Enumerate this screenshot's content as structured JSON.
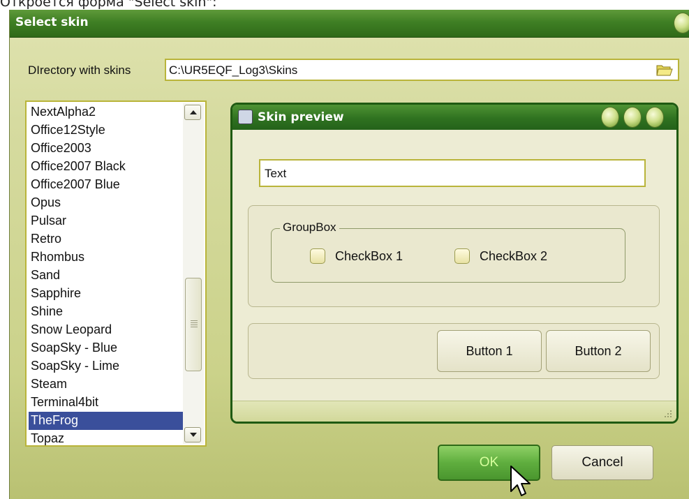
{
  "caption": "Откроется форма \"Select skin\":",
  "window": {
    "title": "Select skin",
    "directory_label": "DIrectory with skins",
    "directory_value": "C:\\UR5EQF_Log3\\Skins",
    "folder_icon": "folder-open-icon"
  },
  "skins": {
    "items": [
      "NextAlpha2",
      "Office12Style",
      "Office2003",
      "Office2007 Black",
      "Office2007 Blue",
      "Opus",
      "Pulsar",
      "Retro",
      "Rhombus",
      "Sand",
      "Sapphire",
      "Shine",
      "Snow Leopard",
      "SoapSky - Blue",
      "SoapSky - Lime",
      "Steam",
      "Terminal4bit",
      "TheFrog",
      "Topaz"
    ],
    "selected": "TheFrog"
  },
  "preview": {
    "title": "Skin preview",
    "text_value": "Text",
    "groupbox_title": "GroupBox",
    "checkbox1_label": "CheckBox 1",
    "checkbox2_label": "CheckBox 2",
    "button1_label": "Button 1",
    "button2_label": "Button 2"
  },
  "buttons": {
    "ok_label": "OK",
    "cancel_label": "Cancel"
  },
  "colors": {
    "titlebar": "#3f7f24",
    "window_bg": "#d6dba0",
    "selection": "#3a4f9b",
    "ok_button": "#5fae3e"
  }
}
